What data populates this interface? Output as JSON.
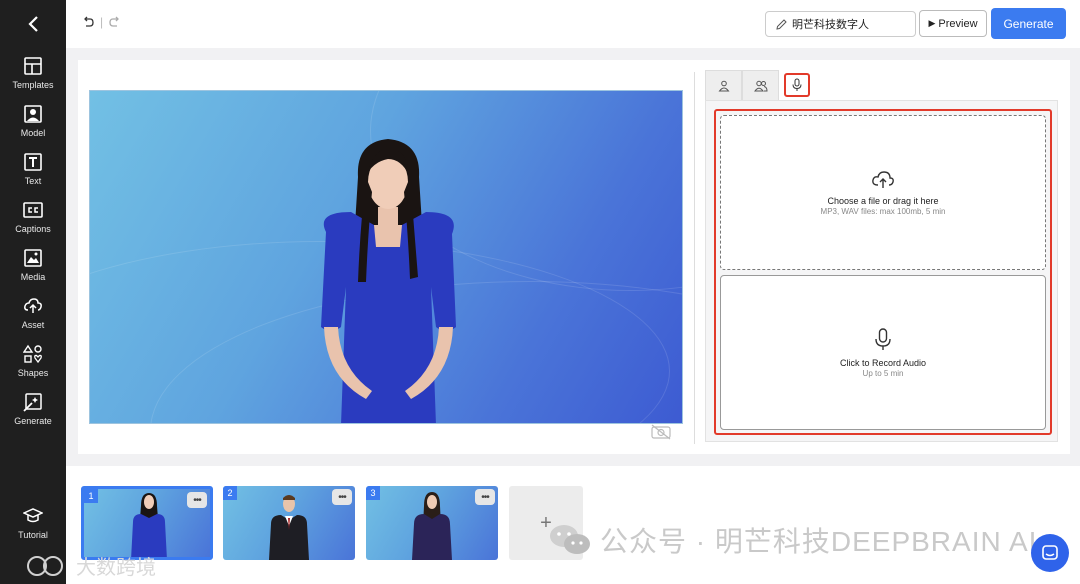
{
  "sidebar": {
    "items": [
      {
        "label": "Templates",
        "icon": "templates-icon"
      },
      {
        "label": "Model",
        "icon": "model-icon"
      },
      {
        "label": "Text",
        "icon": "text-icon"
      },
      {
        "label": "Captions",
        "icon": "captions-icon"
      },
      {
        "label": "Media",
        "icon": "media-icon"
      },
      {
        "label": "Asset",
        "icon": "upload-icon"
      },
      {
        "label": "Shapes",
        "icon": "shapes-icon"
      },
      {
        "label": "Generate",
        "icon": "generate-icon"
      }
    ],
    "tutorial": {
      "label": "Tutorial",
      "icon": "graduation-cap-icon"
    }
  },
  "topbar": {
    "project_title": "明芒科技数字人",
    "preview_label": "Preview",
    "generate_label": "Generate",
    "sep": "|"
  },
  "audio_panel": {
    "upload_title": "Choose a file or drag it here",
    "upload_hint": "MP3, WAV files: max 100mb, 5 min",
    "record_title": "Click to Record Audio",
    "record_hint": "Up to 5 min"
  },
  "scenes": [
    {
      "number": "1",
      "presenter": "woman-blue-dress"
    },
    {
      "number": "2",
      "presenter": "man-suit"
    },
    {
      "number": "3",
      "presenter": "woman-dark-suit"
    }
  ],
  "add_scene_label": "+",
  "more_label": "•••",
  "watermark": {
    "text": "公众号 · 明芒科技DEEPBRAIN AI",
    "corner_text": "大数跨境"
  },
  "colors": {
    "accent": "#3b7bf0",
    "highlight": "#e23a2a",
    "sidebar_bg": "#1f1f1f"
  }
}
